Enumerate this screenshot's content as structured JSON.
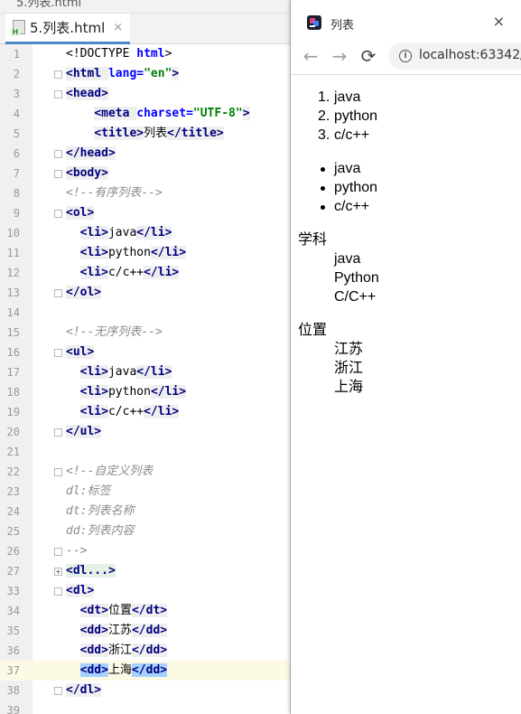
{
  "ide": {
    "top_fragment": "5.列表.html",
    "tab_label": "5.列表.html",
    "tab_close": "×",
    "lines": [
      {
        "n": "1",
        "parts": [
          [
            "tg0",
            "<!DOCTYPE "
          ],
          [
            "at",
            "html"
          ],
          [
            "tg0",
            ">"
          ]
        ]
      },
      {
        "n": "2",
        "parts": [
          [
            "tg",
            "<html "
          ],
          [
            "at",
            "lang="
          ],
          [
            "st",
            "\"en\""
          ],
          [
            "tg",
            ">"
          ]
        ]
      },
      {
        "n": "3",
        "parts": [
          [
            "tg",
            "<head>"
          ]
        ]
      },
      {
        "n": "4",
        "parts": [
          [
            "sp",
            "    "
          ],
          [
            "tg",
            "<meta "
          ],
          [
            "at",
            "charset="
          ],
          [
            "st",
            "\"UTF-8\""
          ],
          [
            "tg",
            ">"
          ]
        ]
      },
      {
        "n": "5",
        "parts": [
          [
            "sp",
            "    "
          ],
          [
            "tg",
            "<title>"
          ],
          [
            "pl",
            "列表"
          ],
          [
            "tg",
            "</title>"
          ]
        ]
      },
      {
        "n": "6",
        "parts": [
          [
            "tg",
            "</head>"
          ]
        ]
      },
      {
        "n": "7",
        "parts": [
          [
            "tg",
            "<body>"
          ]
        ]
      },
      {
        "n": "8",
        "parts": [
          [
            "cm",
            "<!--有序列表-->"
          ]
        ]
      },
      {
        "n": "9",
        "parts": [
          [
            "tg",
            "<ol>"
          ]
        ]
      },
      {
        "n": "10",
        "parts": [
          [
            "sp",
            "  "
          ],
          [
            "tg",
            "<li>"
          ],
          [
            "pl",
            "java"
          ],
          [
            "tg",
            "</li>"
          ]
        ]
      },
      {
        "n": "11",
        "parts": [
          [
            "sp",
            "  "
          ],
          [
            "tg",
            "<li>"
          ],
          [
            "pl",
            "python"
          ],
          [
            "tg",
            "</li>"
          ]
        ]
      },
      {
        "n": "12",
        "parts": [
          [
            "sp",
            "  "
          ],
          [
            "tg",
            "<li>"
          ],
          [
            "pl",
            "c/c++"
          ],
          [
            "tg",
            "</li>"
          ]
        ]
      },
      {
        "n": "13",
        "parts": [
          [
            "tg",
            "</ol>"
          ]
        ]
      },
      {
        "n": "14",
        "parts": []
      },
      {
        "n": "15",
        "parts": [
          [
            "cm",
            "<!--无序列表-->"
          ]
        ]
      },
      {
        "n": "16",
        "parts": [
          [
            "tg",
            "<ul>"
          ]
        ]
      },
      {
        "n": "17",
        "parts": [
          [
            "sp",
            "  "
          ],
          [
            "tg",
            "<li>"
          ],
          [
            "pl",
            "java"
          ],
          [
            "tg",
            "</li>"
          ]
        ]
      },
      {
        "n": "18",
        "parts": [
          [
            "sp",
            "  "
          ],
          [
            "tg",
            "<li>"
          ],
          [
            "pl",
            "python"
          ],
          [
            "tg",
            "</li>"
          ]
        ]
      },
      {
        "n": "19",
        "parts": [
          [
            "sp",
            "  "
          ],
          [
            "tg",
            "<li>"
          ],
          [
            "pl",
            "c/c++"
          ],
          [
            "tg",
            "</li>"
          ]
        ]
      },
      {
        "n": "20",
        "parts": [
          [
            "tg",
            "</ul>"
          ]
        ]
      },
      {
        "n": "21",
        "parts": []
      },
      {
        "n": "22",
        "parts": [
          [
            "cm",
            "<!--自定义列表"
          ]
        ]
      },
      {
        "n": "23",
        "parts": [
          [
            "cm",
            "dl:标签"
          ]
        ]
      },
      {
        "n": "24",
        "parts": [
          [
            "cm",
            "dt:列表名称"
          ]
        ]
      },
      {
        "n": "25",
        "parts": [
          [
            "cm",
            "dd:列表内容"
          ]
        ]
      },
      {
        "n": "26",
        "parts": [
          [
            "cm",
            "-->"
          ]
        ]
      },
      {
        "n": "27",
        "parts": [
          [
            "fd",
            "<dl...>"
          ]
        ]
      },
      {
        "n": "33",
        "parts": [
          [
            "tg",
            "<dl>"
          ]
        ]
      },
      {
        "n": "34",
        "parts": [
          [
            "sp",
            "  "
          ],
          [
            "tg",
            "<dt>"
          ],
          [
            "pl",
            "位置"
          ],
          [
            "tg",
            "</dt>"
          ]
        ]
      },
      {
        "n": "35",
        "parts": [
          [
            "sp",
            "  "
          ],
          [
            "tg",
            "<dd>"
          ],
          [
            "pl",
            "江苏"
          ],
          [
            "tg",
            "</dd>"
          ]
        ]
      },
      {
        "n": "36",
        "parts": [
          [
            "sp",
            "  "
          ],
          [
            "tg",
            "<dd>"
          ],
          [
            "pl",
            "浙江"
          ],
          [
            "tg",
            "</dd>"
          ]
        ]
      },
      {
        "n": "37",
        "parts": [
          [
            "sp",
            "  "
          ],
          [
            "hl",
            "<dd>"
          ],
          [
            "pl",
            "上海"
          ],
          [
            "hl",
            "</dd>"
          ]
        ]
      },
      {
        "n": "38",
        "parts": [
          [
            "tg",
            "</dl>"
          ]
        ]
      },
      {
        "n": "39",
        "parts": []
      }
    ]
  },
  "browser": {
    "tab_title": "列表",
    "tab_close": "×",
    "url": "localhost:63342/",
    "nav": {
      "back": "←",
      "forward": "→",
      "reload": "⟳",
      "info": "i"
    },
    "ordered_list": [
      {
        "marker": "1.",
        "text": "java"
      },
      {
        "marker": "2.",
        "text": "python"
      },
      {
        "marker": "3.",
        "text": "c/c++"
      }
    ],
    "unordered_list": [
      "java",
      "python",
      "c/c++"
    ],
    "definition_lists": [
      {
        "term": "学科",
        "items": [
          "java",
          "Python",
          "C/C++"
        ]
      },
      {
        "term": "位置",
        "items": [
          "江苏",
          "浙江",
          "上海"
        ]
      }
    ]
  },
  "colors": {
    "tag": "#000080",
    "attr": "#0000ff",
    "string": "#008000",
    "comment": "#8c8c8c",
    "highlight": "#a6d2ff",
    "current_line": "#fcfae5"
  }
}
